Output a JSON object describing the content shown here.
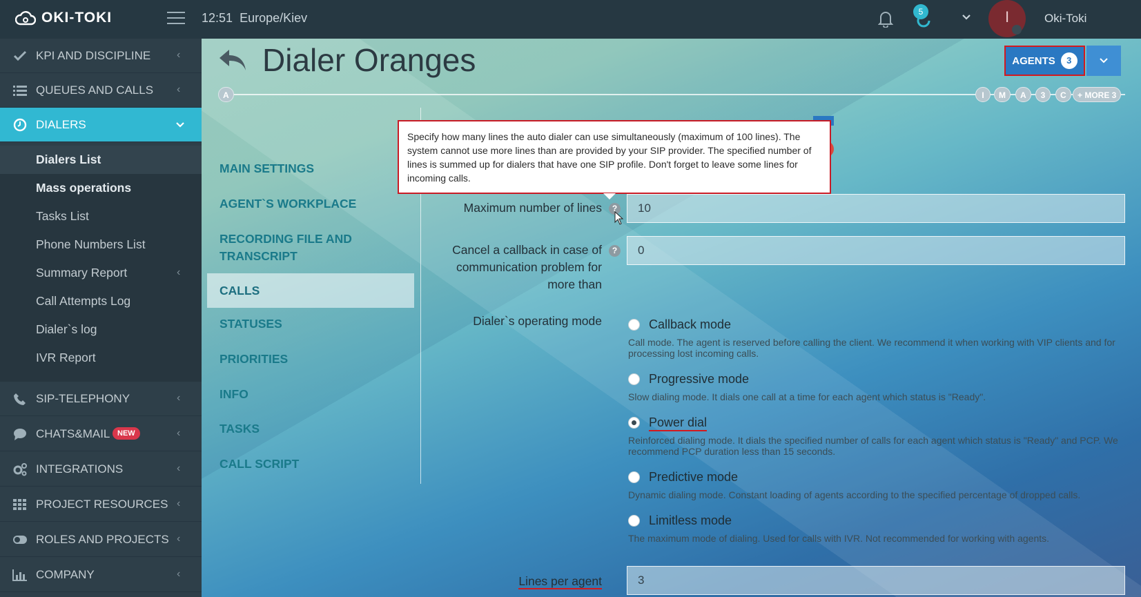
{
  "header": {
    "brand": "OKI-TOKI",
    "time": "12:51",
    "timezone": "Europe/Kiev",
    "notification_count": "5",
    "avatar_letter": "I",
    "username": "Oki-Toki"
  },
  "sidebar": {
    "top_items": [
      {
        "label": "KPI AND DISCIPLINE",
        "icon": "check-icon"
      },
      {
        "label": "QUEUES AND CALLS",
        "icon": "list-icon"
      },
      {
        "label": "DIALERS",
        "icon": "clock-icon",
        "active": true
      }
    ],
    "sub_items": [
      {
        "label": "Dialers List",
        "current": true
      },
      {
        "label": "Mass operations"
      },
      {
        "label": "Tasks List"
      },
      {
        "label": "Phone Numbers List"
      },
      {
        "label": "Summary Report"
      },
      {
        "label": "Call Attempts Log"
      },
      {
        "label": "Dialer`s log"
      },
      {
        "label": "IVR Report"
      }
    ],
    "bottom_items": [
      {
        "label": "SIP-TELEPHONY",
        "icon": "phone-icon"
      },
      {
        "label": "CHATS&MAIL",
        "icon": "chat-icon",
        "badge": "NEW"
      },
      {
        "label": "INTEGRATIONS",
        "icon": "gears-icon"
      },
      {
        "label": "PROJECT RESOURCES",
        "icon": "grid-icon"
      },
      {
        "label": "ROLES AND PROJECTS",
        "icon": "toggle-icon"
      },
      {
        "label": "COMPANY",
        "icon": "bar-chart-icon"
      }
    ]
  },
  "page": {
    "title": "Dialer Oranges",
    "agents_label": "AGENTS",
    "agents_count": "3",
    "timeline_start": "A",
    "timeline_tags": [
      "I",
      "M",
      "A",
      "3",
      "C",
      "+ MORE 3"
    ]
  },
  "tabs": [
    "MAIN SETTINGS",
    "AGENT`S WORKPLACE",
    "RECORDING FILE AND TRANSCRIPT",
    "CALLS",
    "STATUSES",
    "PRIORITIES",
    "INFO",
    "TASKS",
    "CALL SCRIPT"
  ],
  "active_tab": "CALLS",
  "tooltip": "Specify how many lines the auto dialer can use simultaneously (maximum of 100 lines). The system cannot use more lines than are provided by your SIP provider. The specified number of lines is summed up for dialers that have one SIP profile. Don't forget to leave some lines for incoming calls.",
  "form": {
    "max_lines_label": "Maximum number of lines",
    "max_lines_value": "10",
    "cancel_callback_label": "Cancel a callback in case of communication problem for more than",
    "cancel_callback_value": "0",
    "mode_label": "Dialer`s operating mode",
    "modes": [
      {
        "label": "Callback mode",
        "desc": "Call mode. The agent is reserved before calling the client. We recommend it when working with VIP clients and for processing lost incoming calls.",
        "checked": false
      },
      {
        "label": "Progressive mode",
        "desc": "Slow dialing mode. It dials one call at a time for each agent which status is \"Ready\".",
        "checked": false
      },
      {
        "label": "Power dial",
        "desc": "Reinforced dialing mode. It dials the specified number of calls for each agent which status is \"Ready\" and PCP. We recommend PCP duration less than 15 seconds.",
        "checked": true
      },
      {
        "label": "Predictive mode",
        "desc": "Dynamic dialing mode. Constant loading of agents according to the specified percentage of dropped calls.",
        "checked": false
      },
      {
        "label": "Limitless mode",
        "desc": "The maximum mode of dialing. Used for calls with IVR. Not recommended for working with agents.",
        "checked": false
      }
    ],
    "lines_per_agent_label": "Lines per agent",
    "lines_per_agent_value": "3"
  }
}
